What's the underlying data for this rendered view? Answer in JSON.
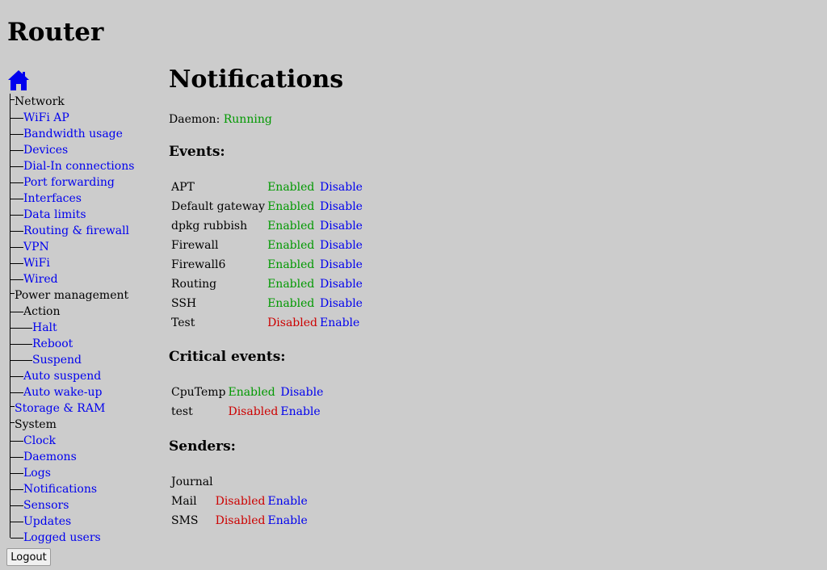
{
  "app": {
    "title": "Router"
  },
  "nav": {
    "home_icon": "home-icon",
    "items": [
      {
        "label": "Network",
        "depth": 0,
        "link": false,
        "last": false
      },
      {
        "label": "WiFi AP",
        "depth": 1,
        "link": true,
        "last": false
      },
      {
        "label": "Bandwidth usage",
        "depth": 1,
        "link": true,
        "last": false
      },
      {
        "label": "Devices",
        "depth": 1,
        "link": true,
        "last": false
      },
      {
        "label": "Dial-In connections",
        "depth": 1,
        "link": true,
        "last": false
      },
      {
        "label": "Port forwarding",
        "depth": 1,
        "link": true,
        "last": false
      },
      {
        "label": "Interfaces",
        "depth": 1,
        "link": true,
        "last": false
      },
      {
        "label": "Data limits",
        "depth": 1,
        "link": true,
        "last": false
      },
      {
        "label": "Routing & firewall",
        "depth": 1,
        "link": true,
        "last": false
      },
      {
        "label": "VPN",
        "depth": 1,
        "link": true,
        "last": false
      },
      {
        "label": "WiFi",
        "depth": 1,
        "link": true,
        "last": false
      },
      {
        "label": "Wired",
        "depth": 1,
        "link": true,
        "last": false
      },
      {
        "label": "Power management",
        "depth": 0,
        "link": false,
        "last": false
      },
      {
        "label": "Action",
        "depth": 1,
        "link": false,
        "last": false
      },
      {
        "label": "Halt",
        "depth": 2,
        "link": true,
        "last": false
      },
      {
        "label": "Reboot",
        "depth": 2,
        "link": true,
        "last": false
      },
      {
        "label": "Suspend",
        "depth": 2,
        "link": true,
        "last": false
      },
      {
        "label": "Auto suspend",
        "depth": 1,
        "link": true,
        "last": false
      },
      {
        "label": "Auto wake-up",
        "depth": 1,
        "link": true,
        "last": false
      },
      {
        "label": "Storage & RAM",
        "depth": 0,
        "link": true,
        "last": false
      },
      {
        "label": "System",
        "depth": 0,
        "link": false,
        "last": false
      },
      {
        "label": "Clock",
        "depth": 1,
        "link": true,
        "last": false
      },
      {
        "label": "Daemons",
        "depth": 1,
        "link": true,
        "last": false
      },
      {
        "label": "Logs",
        "depth": 1,
        "link": true,
        "last": false
      },
      {
        "label": "Notifications",
        "depth": 1,
        "link": true,
        "last": false
      },
      {
        "label": "Sensors",
        "depth": 1,
        "link": true,
        "last": false
      },
      {
        "label": "Updates",
        "depth": 1,
        "link": true,
        "last": false
      },
      {
        "label": "Logged users",
        "depth": 1,
        "link": true,
        "last": true
      }
    ],
    "logout_label": "Logout"
  },
  "main": {
    "title": "Notifications",
    "daemon": {
      "label": "Daemon:",
      "status": "Running"
    },
    "events": {
      "heading": "Events:",
      "rows": [
        {
          "name": "APT",
          "status": "Enabled",
          "action": "Disable"
        },
        {
          "name": "Default gateway",
          "status": "Enabled",
          "action": "Disable"
        },
        {
          "name": "dpkg rubbish",
          "status": "Enabled",
          "action": "Disable"
        },
        {
          "name": "Firewall",
          "status": "Enabled",
          "action": "Disable"
        },
        {
          "name": "Firewall6",
          "status": "Enabled",
          "action": "Disable"
        },
        {
          "name": "Routing",
          "status": "Enabled",
          "action": "Disable"
        },
        {
          "name": "SSH",
          "status": "Enabled",
          "action": "Disable"
        },
        {
          "name": "Test",
          "status": "Disabled",
          "action": "Enable"
        }
      ]
    },
    "critical": {
      "heading": "Critical events:",
      "rows": [
        {
          "name": "CpuTemp",
          "status": "Enabled",
          "action": "Disable"
        },
        {
          "name": "test",
          "status": "Disabled",
          "action": "Enable"
        }
      ]
    },
    "senders": {
      "heading": "Senders:",
      "rows": [
        {
          "name": "Journal",
          "status": "",
          "action": ""
        },
        {
          "name": "Mail",
          "status": "Disabled",
          "action": "Enable"
        },
        {
          "name": "SMS",
          "status": "Disabled",
          "action": "Enable"
        }
      ]
    }
  },
  "colors": {
    "background": "#cccccc",
    "link": "#0000ee",
    "enabled": "#009900",
    "disabled": "#cc0000"
  }
}
